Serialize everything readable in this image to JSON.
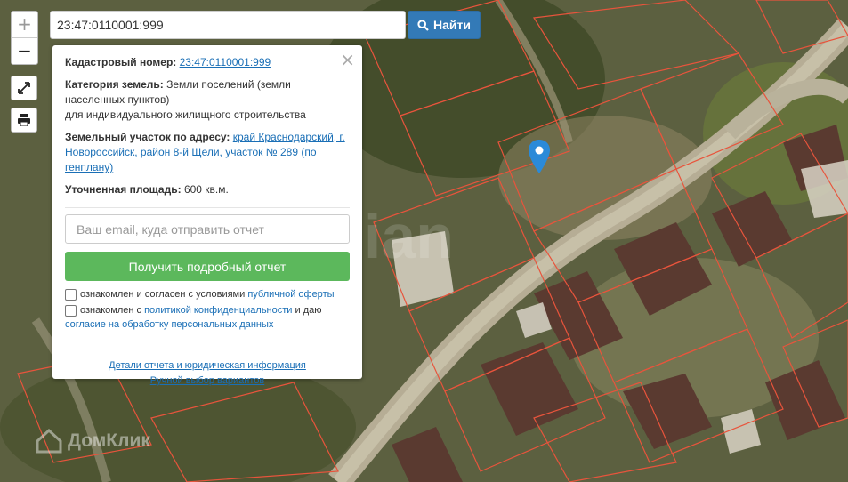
{
  "search": {
    "value": "23:47:0110001:999"
  },
  "find_button": {
    "label": "Найти"
  },
  "zoom": {
    "in": "+",
    "out": "−"
  },
  "popup": {
    "cadastral_label": "Кадастровый номер:",
    "cadastral_value": "23:47:0110001:999",
    "category_label": "Категория земель:",
    "category_value": "Земли поселений (земли населенных пунктов)",
    "category_value2": "для индивидуального жилищного строительства",
    "address_label": "Земельный участок по адресу:",
    "address_value": "край Краснодарский, г. Новороссийск, район 8-й Щели, участок № 289 (по генплану)",
    "area_label": "Уточненная площадь:",
    "area_value": "600 кв.м.",
    "email_placeholder": "Ваш email, куда отправить отчет",
    "get_report": "Получить подробный отчет",
    "agree1_text": "ознакомлен и согласен с условиями",
    "agree1_link": "публичной оферты",
    "agree2_text": "ознакомлен с",
    "agree2_link": "политикой конфиденциальности",
    "agree2_text2": "и даю",
    "agree2_link2": "согласие на обработку персональных данных",
    "details_link": "Детали отчета и юридическая информация",
    "manual_link": "Ручной выбор вариантов",
    "close": "×"
  },
  "logo": {
    "text": "ДомКлик"
  },
  "icons": {
    "search": "search-icon",
    "fullscreen": "fullscreen-icon",
    "print": "print-icon",
    "pin": "map-pin-icon",
    "close": "close-icon"
  },
  "colors": {
    "find_button": "#337ab7",
    "report_button": "#5cb85c",
    "link": "#1a6fb6",
    "parcel_border": "#e8543c",
    "pin": "#2b8ad8"
  }
}
